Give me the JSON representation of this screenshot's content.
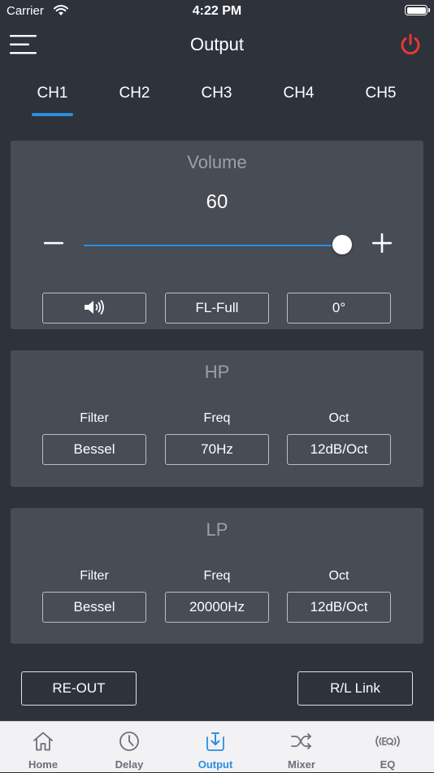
{
  "status_bar": {
    "carrier": "Carrier",
    "time": "4:22 PM",
    "battery_level": 1.0
  },
  "nav": {
    "title": "Output"
  },
  "channels": [
    {
      "label": "CH1",
      "active": true
    },
    {
      "label": "CH2",
      "active": false
    },
    {
      "label": "CH3",
      "active": false
    },
    {
      "label": "CH4",
      "active": false
    },
    {
      "label": "CH5",
      "active": false
    }
  ],
  "volume": {
    "title": "Volume",
    "value": "60",
    "slider_fraction": 1.0,
    "mute_icon": "speaker-icon",
    "position_label": "FL-Full",
    "phase_label": "0°"
  },
  "hp": {
    "title": "HP",
    "filter_label": "Filter",
    "filter_value": "Bessel",
    "freq_label": "Freq",
    "freq_value": "70Hz",
    "oct_label": "Oct",
    "oct_value": "12dB/Oct"
  },
  "lp": {
    "title": "LP",
    "filter_label": "Filter",
    "filter_value": "Bessel",
    "freq_label": "Freq",
    "freq_value": "20000Hz",
    "oct_label": "Oct",
    "oct_value": "12dB/Oct"
  },
  "actions": {
    "re_out": "RE-OUT",
    "rl_link": "R/L Link"
  },
  "tab_bar": {
    "items": [
      {
        "label": "Home",
        "icon": "home-icon",
        "active": false
      },
      {
        "label": "Delay",
        "icon": "clock-icon",
        "active": false
      },
      {
        "label": "Output",
        "icon": "output-icon",
        "active": true
      },
      {
        "label": "Mixer",
        "icon": "shuffle-icon",
        "active": false
      },
      {
        "label": "EQ",
        "icon": "eq-icon",
        "active": false
      }
    ]
  },
  "colors": {
    "background": "#2e323a",
    "panel": "#474c55",
    "accent": "#2a8fe0",
    "power": "#e53935",
    "tab_bar": "#f2f2f5"
  }
}
